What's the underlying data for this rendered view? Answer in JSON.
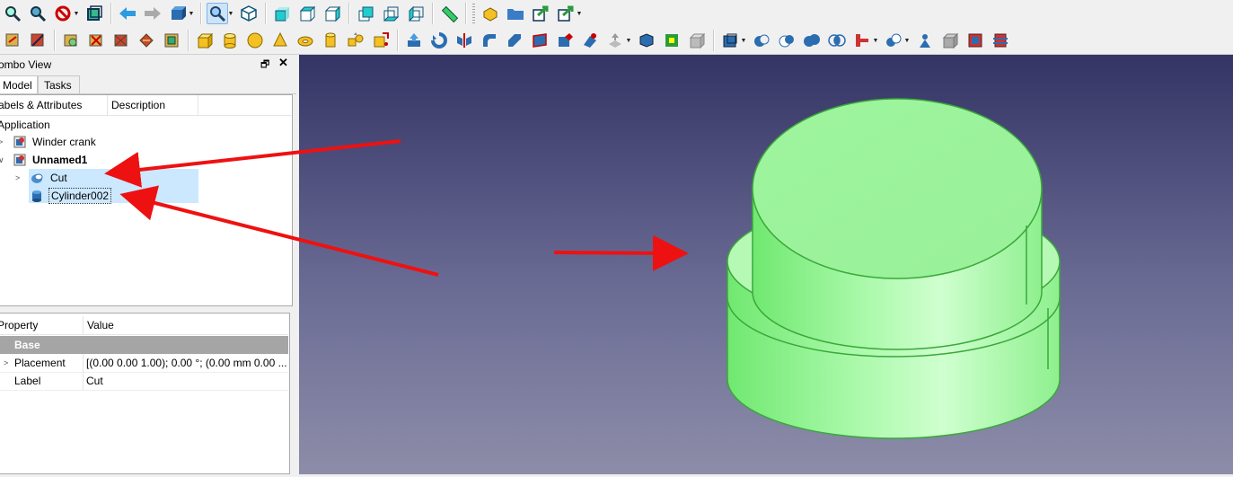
{
  "combo": {
    "title": "ombo View",
    "tabs": [
      "Model",
      "Tasks"
    ],
    "columns": [
      "abels & Attributes",
      "Description"
    ],
    "tree": {
      "root": "Application",
      "items": [
        {
          "label": "Winder crank"
        },
        {
          "label": "Unnamed1"
        },
        {
          "label": "Cut"
        },
        {
          "label": "Cylinder002"
        }
      ]
    }
  },
  "properties": {
    "headers": [
      "Property",
      "Value"
    ],
    "group": "Base",
    "rows": [
      {
        "name": "Placement",
        "value": "[(0.00 0.00 1.00); 0.00 °; (0.00 mm  0.00 ..."
      },
      {
        "name": "Label",
        "value": "Cut"
      }
    ]
  },
  "icons": {
    "restore": "🗗",
    "close": "✕"
  },
  "colors": {
    "selection": "#cce8ff",
    "model_green": "#9cf59c",
    "arrow": "#ee1111",
    "viewport_top": "#343465",
    "viewport_bottom": "#8d8da9"
  }
}
